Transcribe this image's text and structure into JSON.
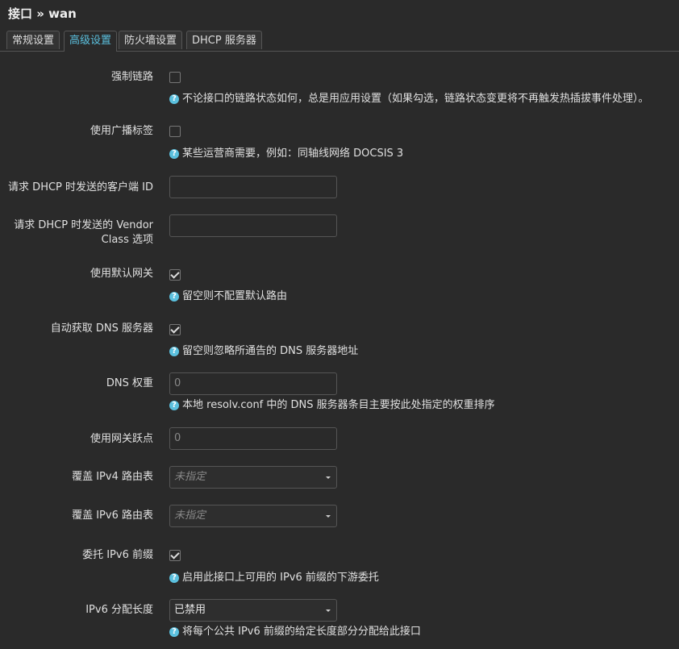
{
  "page": {
    "title": "接口 » wan"
  },
  "tabs": [
    {
      "label": "常规设置"
    },
    {
      "label": "高级设置"
    },
    {
      "label": "防火墙设置"
    },
    {
      "label": "DHCP 服务器"
    }
  ],
  "fields": {
    "force_link": {
      "label": "强制链路",
      "checked": false,
      "help": "不论接口的链路状态如何，总是用应用设置（如果勾选，链路状态变更将不再触发热插拔事件处理）。"
    },
    "broadcast_flag": {
      "label": "使用广播标签",
      "checked": false,
      "help": "某些运营商需要，例如：同轴线网络 DOCSIS 3"
    },
    "client_id": {
      "label": "请求 DHCP 时发送的客户端 ID",
      "value": ""
    },
    "vendor_class": {
      "label": "请求 DHCP 时发送的 Vendor Class 选项",
      "value": ""
    },
    "default_gateway": {
      "label": "使用默认网关",
      "checked": true,
      "help": "留空则不配置默认路由"
    },
    "peer_dns": {
      "label": "自动获取 DNS 服务器",
      "checked": true,
      "help": "留空则忽略所通告的 DNS 服务器地址"
    },
    "dns_weight": {
      "label": "DNS 权重",
      "placeholder": "0",
      "help": "本地 resolv.conf 中的 DNS 服务器条目主要按此处指定的权重排序"
    },
    "metric": {
      "label": "使用网关跃点",
      "placeholder": "0"
    },
    "ip4table": {
      "label": "覆盖 IPv4 路由表",
      "value": "未指定"
    },
    "ip6table": {
      "label": "覆盖 IPv6 路由表",
      "value": "未指定"
    },
    "delegate": {
      "label": "委托 IPv6 前缀",
      "checked": true,
      "help": "启用此接口上可用的 IPv6 前缀的下游委托"
    },
    "ip6assign": {
      "label": "IPv6 分配长度",
      "value": "已禁用",
      "help": "将每个公共 IPv6 前缀的给定长度部分分配给此接口"
    }
  },
  "colors": {
    "accent": "#5bc0de",
    "background": "#2a2a2a"
  }
}
